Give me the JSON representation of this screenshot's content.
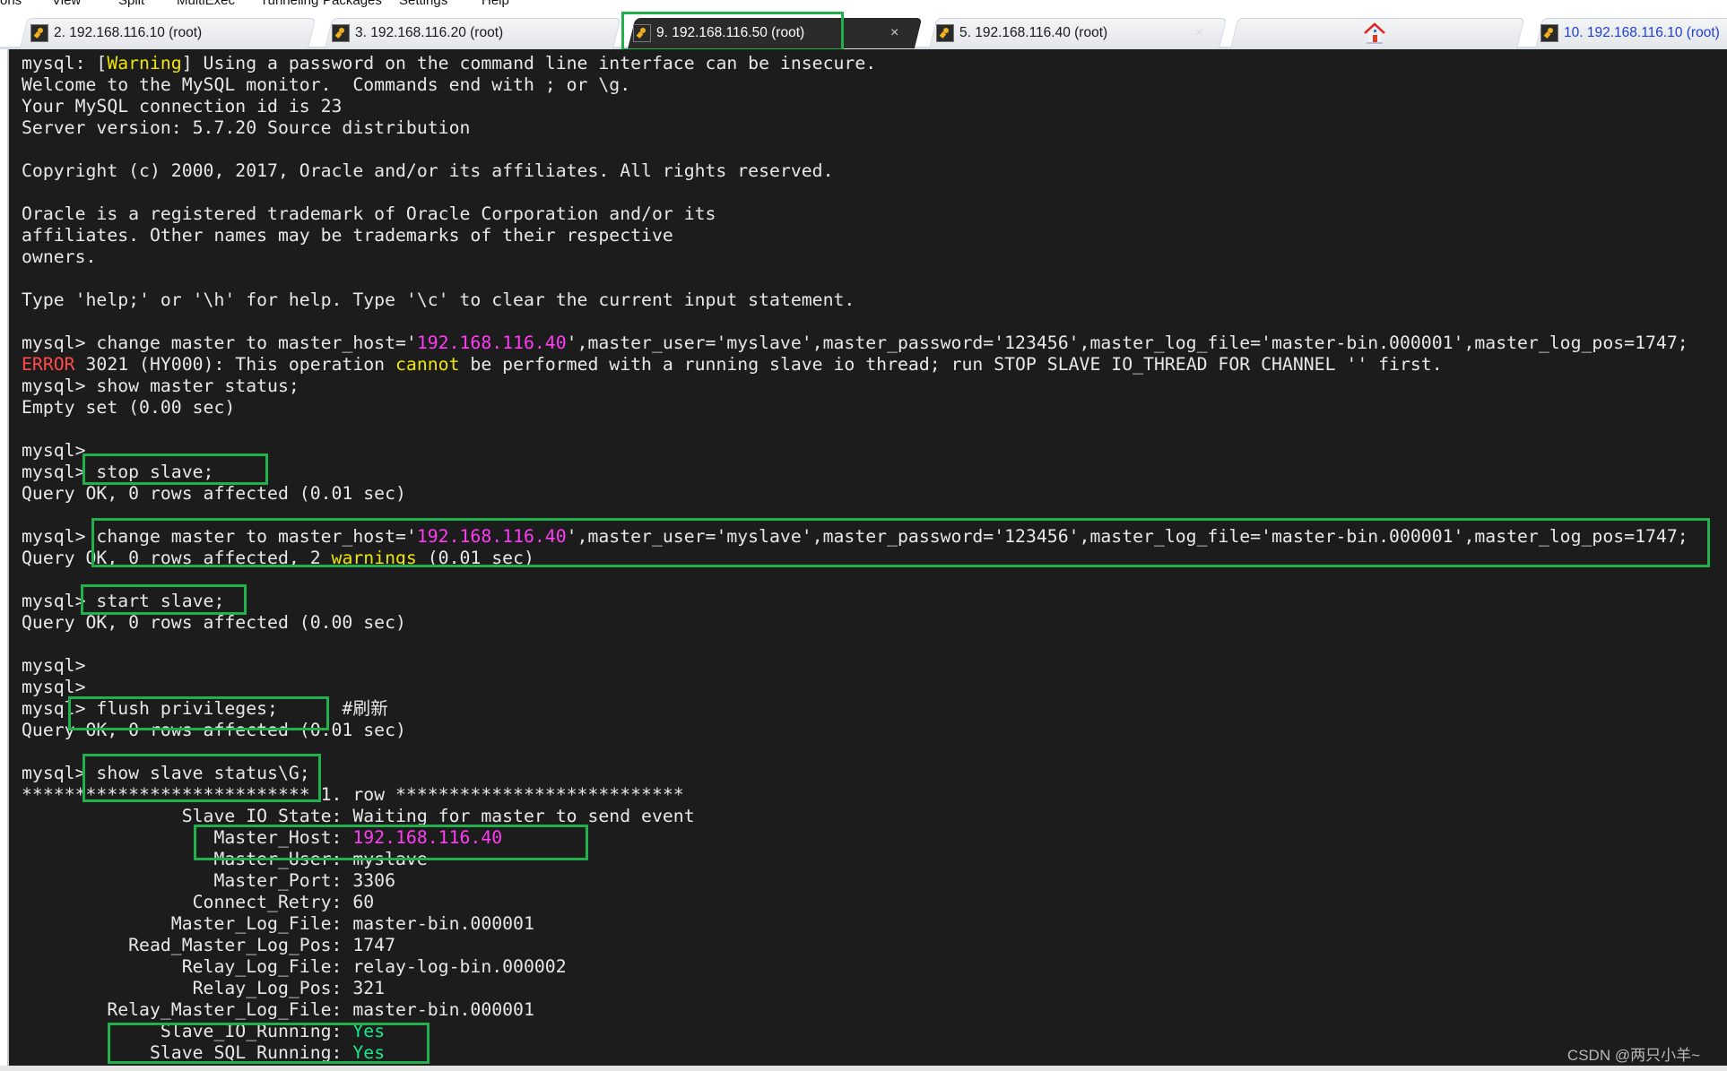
{
  "menu": [
    "ons",
    "View",
    "Split",
    "MultiExec",
    "Tunneling",
    "Packages",
    "Settings",
    "Help"
  ],
  "tabs": [
    {
      "label": "2. 192.168.116.10 (root)",
      "active": false
    },
    {
      "label": "3. 192.168.116.20 (root)",
      "active": false
    },
    {
      "label": "9. 192.168.116.50 (root)",
      "active": true
    },
    {
      "label": "5. 192.168.116.40 (root)",
      "active": false
    },
    {
      "label": "",
      "icon": "home-icon"
    },
    {
      "label": "10. 192.168.116.10 (root)",
      "active": false
    }
  ],
  "close_glyph": "×",
  "terminal": {
    "lines": [
      [
        [
          "mysql: ["
        ],
        [
          "Warning",
          "y"
        ],
        [
          "] Using a password on the command line interface can be insecure."
        ]
      ],
      [
        [
          "Welcome to the MySQL monitor.  Commands end with ; or \\g."
        ]
      ],
      [
        [
          "Your MySQL connection id is 23"
        ]
      ],
      [
        [
          "Server version: 5.7.20 Source distribution"
        ]
      ],
      [
        [
          ""
        ]
      ],
      [
        [
          "Copyright (c) 2000, 2017, Oracle and/or its affiliates. All rights reserved."
        ]
      ],
      [
        [
          ""
        ]
      ],
      [
        [
          "Oracle is a registered trademark of Oracle Corporation and/or its"
        ]
      ],
      [
        [
          "affiliates. Other names may be trademarks of their respective"
        ]
      ],
      [
        [
          "owners."
        ]
      ],
      [
        [
          ""
        ]
      ],
      [
        [
          "Type 'help;' or '\\h' for help. Type '\\c' to clear the current input statement."
        ]
      ],
      [
        [
          ""
        ]
      ],
      [
        [
          "mysql> change master to master_host='"
        ],
        [
          "192.168.116.40",
          "m"
        ],
        [
          "',master_user='myslave',master_password='123456',master_log_file='master-bin.000001',master_log_pos=1747;"
        ]
      ],
      [
        [
          "ERROR",
          "r"
        ],
        [
          " 3021 (HY000): This operation "
        ],
        [
          "cannot",
          "y"
        ],
        [
          " be performed with a running slave io thread; run STOP SLAVE IO_THREAD FOR CHANNEL '' first."
        ]
      ],
      [
        [
          "mysql> show master status;"
        ]
      ],
      [
        [
          "Empty set (0.00 sec)"
        ]
      ],
      [
        [
          ""
        ]
      ],
      [
        [
          "mysql>"
        ]
      ],
      [
        [
          "mysql> stop slave;"
        ]
      ],
      [
        [
          "Query OK, 0 rows affected (0.01 sec)"
        ]
      ],
      [
        [
          ""
        ]
      ],
      [
        [
          "mysql> change master to master_host='"
        ],
        [
          "192.168.116.40",
          "m"
        ],
        [
          "',master_user='myslave',master_password='123456',master_log_file='master-bin.000001',master_log_pos=1747;"
        ]
      ],
      [
        [
          "Query OK, 0 rows affected, 2 "
        ],
        [
          "warnings",
          "y"
        ],
        [
          " (0.01 sec)"
        ]
      ],
      [
        [
          ""
        ]
      ],
      [
        [
          "mysql> start slave;"
        ]
      ],
      [
        [
          "Query OK, 0 rows affected (0.00 sec)"
        ]
      ],
      [
        [
          ""
        ]
      ],
      [
        [
          "mysql>"
        ]
      ],
      [
        [
          "mysql>"
        ]
      ],
      [
        [
          "mysql> flush privileges;      #刷新"
        ]
      ],
      [
        [
          "Query OK, 0 rows affected (0.01 sec)"
        ]
      ],
      [
        [
          ""
        ]
      ],
      [
        [
          "mysql> show slave status\\G;"
        ]
      ],
      [
        [
          "*************************** 1. row ***************************"
        ]
      ],
      [
        [
          "               Slave_IO_State: Waiting for master to send event"
        ]
      ],
      [
        [
          "                  Master_Host: "
        ],
        [
          "192.168.116.40",
          "m"
        ]
      ],
      [
        [
          "                  Master_User: myslave"
        ]
      ],
      [
        [
          "                  Master_Port: 3306"
        ]
      ],
      [
        [
          "                Connect_Retry: 60"
        ]
      ],
      [
        [
          "              Master_Log_File: master-bin.000001"
        ]
      ],
      [
        [
          "          Read_Master_Log_Pos: 1747"
        ]
      ],
      [
        [
          "               Relay_Log_File: relay-log-bin.000002"
        ]
      ],
      [
        [
          "                Relay_Log_Pos: 321"
        ]
      ],
      [
        [
          "        Relay_Master_Log_File: master-bin.000001"
        ]
      ],
      [
        [
          "             Slave_IO_Running: "
        ],
        [
          "Yes",
          "g"
        ]
      ],
      [
        [
          "            Slave_SQL_Running: "
        ],
        [
          "Yes",
          "g"
        ]
      ]
    ]
  },
  "highlight_boxes": [
    "stop-slave",
    "change-master",
    "start-slave",
    "flush-privileges",
    "show-slave-status",
    "master-host",
    "slave-running"
  ],
  "watermark": "CSDN @两只小羊~",
  "colors": {
    "terminal_bg": "#1c1c1c",
    "terminal_fg": "#e8e8e8",
    "warning_yellow": "#f0e500",
    "error_red": "#ff4a4a",
    "ip_magenta": "#ff3cf5",
    "yes_green": "#19e88a",
    "highlight_box": "#21b04b"
  }
}
